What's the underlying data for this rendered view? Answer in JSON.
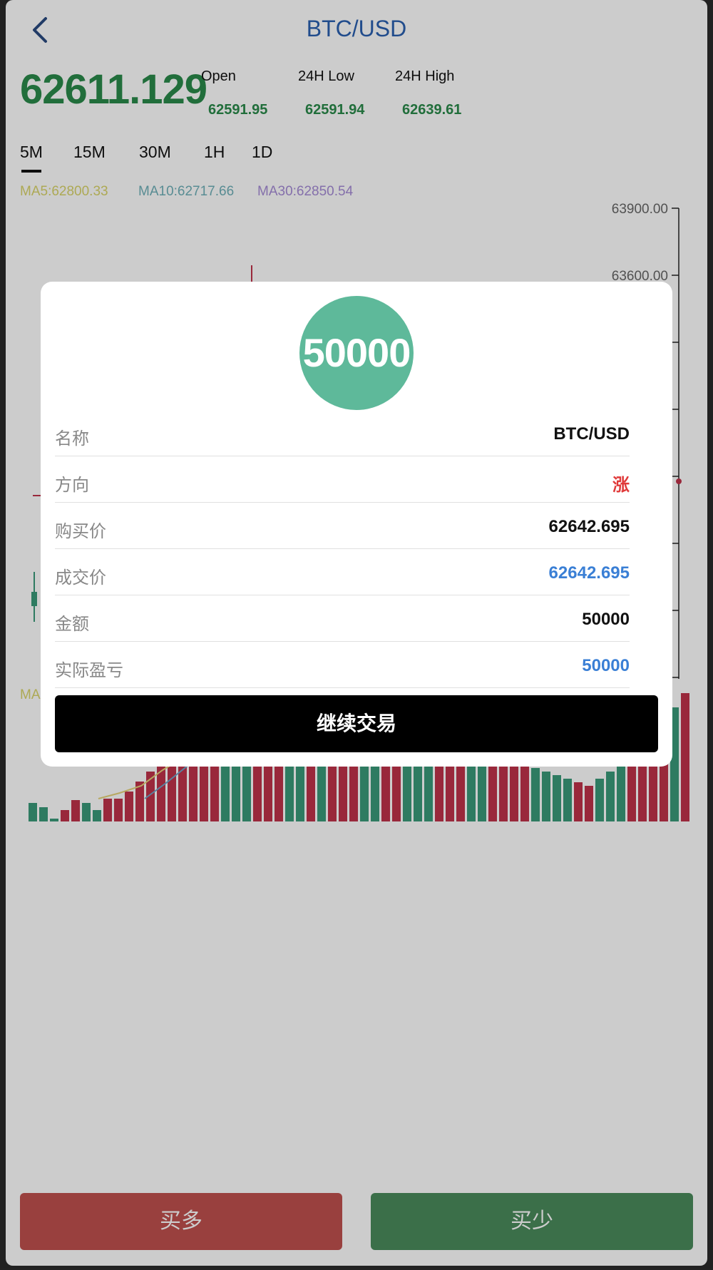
{
  "header": {
    "title": "BTC/USD"
  },
  "ticker": {
    "price": "62611.129",
    "open_label": "Open",
    "open_value": "62591.95",
    "low_label": "24H Low",
    "low_value": "62591.94",
    "high_label": "24H High",
    "high_value": "62639.61"
  },
  "tabs": [
    {
      "label": "5M",
      "active": true
    },
    {
      "label": "15M"
    },
    {
      "label": "30M"
    },
    {
      "label": "1H"
    },
    {
      "label": "1D"
    }
  ],
  "ma": {
    "ma5": "MA5:62800.33",
    "ma10": "MA10:62717.66",
    "ma30": "MA30:62850.54",
    "vol_ma_prefix": "MA"
  },
  "chart_data": {
    "type": "candlestick",
    "y_ticks": [
      "63900.00",
      "63600.00"
    ],
    "colors": {
      "up": "#c0334a",
      "down": "#3a9a7a"
    }
  },
  "modal": {
    "amount": "50000",
    "rows": [
      {
        "key": "名称",
        "value": "BTC/USD",
        "color": "#111111"
      },
      {
        "key": "方向",
        "value": "涨",
        "color": "#e03a3a"
      },
      {
        "key": "购买价",
        "value": "62642.695",
        "color": "#111111"
      },
      {
        "key": "成交价",
        "value": "62642.695",
        "color": "#3a7fd5"
      },
      {
        "key": "金额",
        "value": "50000",
        "color": "#111111"
      },
      {
        "key": "实际盈亏",
        "value": "50000",
        "color": "#3a7fd5"
      }
    ],
    "continue_label": "继续交易"
  },
  "footer": {
    "buy_long": "买多",
    "buy_short": "买少"
  },
  "colors": {
    "up": "#c0334a",
    "down": "#3a9a7a",
    "buy_long_bg": "#c0504e",
    "buy_short_bg": "#4a8b5c"
  }
}
